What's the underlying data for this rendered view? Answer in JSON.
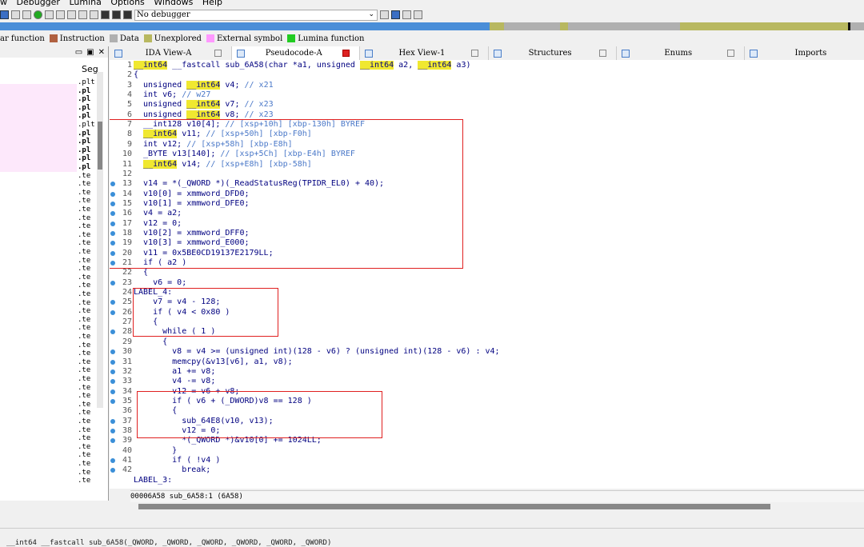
{
  "menu": [
    "w",
    "Debugger",
    "Lumina",
    "Options",
    "Windows",
    "Help"
  ],
  "toolbar": {
    "debugger_select": "No debugger"
  },
  "legend": [
    {
      "label": "ar function",
      "color": "#8a7a3a"
    },
    {
      "label": "Instruction",
      "color": "#b06040"
    },
    {
      "label": "Data",
      "color": "#b0b0b0"
    },
    {
      "label": "Unexplored",
      "color": "#b8b860"
    },
    {
      "label": "External symbol",
      "color": "#ff99ff"
    },
    {
      "label": "Lumina function",
      "color": "#22cc22"
    }
  ],
  "left_panel": {
    "header_icons": [
      "restore-icon",
      "maximize-icon",
      "close-icon"
    ],
    "column_label": "Seg",
    "segments": [
      ".plt",
      ".pl",
      ".pl",
      ".pl",
      ".pl",
      ".plt",
      ".pl",
      ".pl",
      ".pl",
      ".pl",
      ".pl",
      ".te",
      ".te",
      ".te",
      ".te",
      ".te",
      ".te",
      ".te",
      ".te",
      ".te",
      ".te",
      ".te",
      ".te",
      ".te",
      ".te",
      ".te",
      ".te",
      ".te",
      ".te",
      ".te",
      ".te",
      ".te",
      ".te",
      ".te",
      ".te",
      ".te",
      ".te",
      ".te",
      ".te",
      ".te",
      ".te",
      ".te",
      ".te",
      ".te",
      ".te",
      ".te",
      ".te",
      ".te"
    ]
  },
  "tabs": [
    {
      "label": "IDA View-A",
      "active": false
    },
    {
      "label": "Pseudocode-A",
      "active": true
    },
    {
      "label": "Hex View-1",
      "active": false
    },
    {
      "label": "Structures",
      "active": false
    },
    {
      "label": "Enums",
      "active": false
    },
    {
      "label": "Imports",
      "active": false
    }
  ],
  "code_lines": [
    {
      "n": "1",
      "bp": false,
      "t": "__int64 __fastcall sub_6A58(char *a1, unsigned __int64 a2, __int64 a3)"
    },
    {
      "n": "2",
      "bp": false,
      "t": "{"
    },
    {
      "n": "3",
      "bp": false,
      "t": "  unsigned __int64 v4; // x21"
    },
    {
      "n": "4",
      "bp": false,
      "t": "  int v6; // w27"
    },
    {
      "n": "5",
      "bp": false,
      "t": "  unsigned __int64 v7; // x23"
    },
    {
      "n": "6",
      "bp": false,
      "t": "  unsigned __int64 v8; // x23"
    },
    {
      "n": "7",
      "bp": false,
      "t": "  __int128 v10[4]; // [xsp+10h] [xbp-130h] BYREF"
    },
    {
      "n": "8",
      "bp": false,
      "t": "  __int64 v11; // [xsp+50h] [xbp-F0h]"
    },
    {
      "n": "9",
      "bp": false,
      "t": "  int v12; // [xsp+58h] [xbp-E8h]"
    },
    {
      "n": "10",
      "bp": false,
      "t": "  _BYTE v13[140]; // [xsp+5Ch] [xbp-E4h] BYREF"
    },
    {
      "n": "11",
      "bp": false,
      "t": "  __int64 v14; // [xsp+E8h] [xbp-58h]"
    },
    {
      "n": "12",
      "bp": false,
      "t": ""
    },
    {
      "n": "13",
      "bp": true,
      "t": "  v14 = *(_QWORD *)(_ReadStatusReg(TPIDR_EL0) + 40);"
    },
    {
      "n": "14",
      "bp": true,
      "t": "  v10[0] = xmmword_DFD0;"
    },
    {
      "n": "15",
      "bp": true,
      "t": "  v10[1] = xmmword_DFE0;"
    },
    {
      "n": "16",
      "bp": true,
      "t": "  v4 = a2;"
    },
    {
      "n": "17",
      "bp": true,
      "t": "  v12 = 0;"
    },
    {
      "n": "18",
      "bp": true,
      "t": "  v10[2] = xmmword_DFF0;"
    },
    {
      "n": "19",
      "bp": true,
      "t": "  v10[3] = xmmword_E000;"
    },
    {
      "n": "20",
      "bp": true,
      "t": "  v11 = 0x5BE0CD19137E2179LL;"
    },
    {
      "n": "21",
      "bp": true,
      "t": "  if ( a2 )"
    },
    {
      "n": "22",
      "bp": false,
      "t": "  {"
    },
    {
      "n": "23",
      "bp": true,
      "t": "    v6 = 0;"
    },
    {
      "n": "24",
      "bp": false,
      "t": "LABEL_4:"
    },
    {
      "n": "25",
      "bp": true,
      "t": "    v7 = v4 - 128;"
    },
    {
      "n": "26",
      "bp": true,
      "t": "    if ( v4 < 0x80 )"
    },
    {
      "n": "27",
      "bp": false,
      "t": "    {"
    },
    {
      "n": "28",
      "bp": true,
      "t": "      while ( 1 )"
    },
    {
      "n": "29",
      "bp": false,
      "t": "      {"
    },
    {
      "n": "30",
      "bp": true,
      "t": "        v8 = v4 >= (unsigned int)(128 - v6) ? (unsigned int)(128 - v6) : v4;"
    },
    {
      "n": "31",
      "bp": true,
      "t": "        memcpy(&v13[v6], a1, v8);"
    },
    {
      "n": "32",
      "bp": true,
      "t": "        a1 += v8;"
    },
    {
      "n": "33",
      "bp": true,
      "t": "        v4 -= v8;"
    },
    {
      "n": "34",
      "bp": true,
      "t": "        v12 = v6 + v8;"
    },
    {
      "n": "35",
      "bp": true,
      "t": "        if ( v6 + (_DWORD)v8 == 128 )"
    },
    {
      "n": "36",
      "bp": false,
      "t": "        {"
    },
    {
      "n": "37",
      "bp": true,
      "t": "          sub_64E8(v10, v13);"
    },
    {
      "n": "38",
      "bp": true,
      "t": "          v12 = 0;"
    },
    {
      "n": "39",
      "bp": true,
      "t": "          *(_QWORD *)&v10[0] += 1024LL;"
    },
    {
      "n": "40",
      "bp": false,
      "t": "        }"
    },
    {
      "n": "41",
      "bp": true,
      "t": "        if ( !v4 )"
    },
    {
      "n": "42",
      "bp": true,
      "t": "          break;"
    },
    {
      "n": "",
      "bp": false,
      "t": "LABEL_3:"
    }
  ],
  "status": {
    "address": "00006A58",
    "location": "sub_6A58:1 (6A58)"
  },
  "output": "__int64 __fastcall sub_6A58(_QWORD, _QWORD, _QWORD, _QWORD, _QWORD, _QWORD)"
}
